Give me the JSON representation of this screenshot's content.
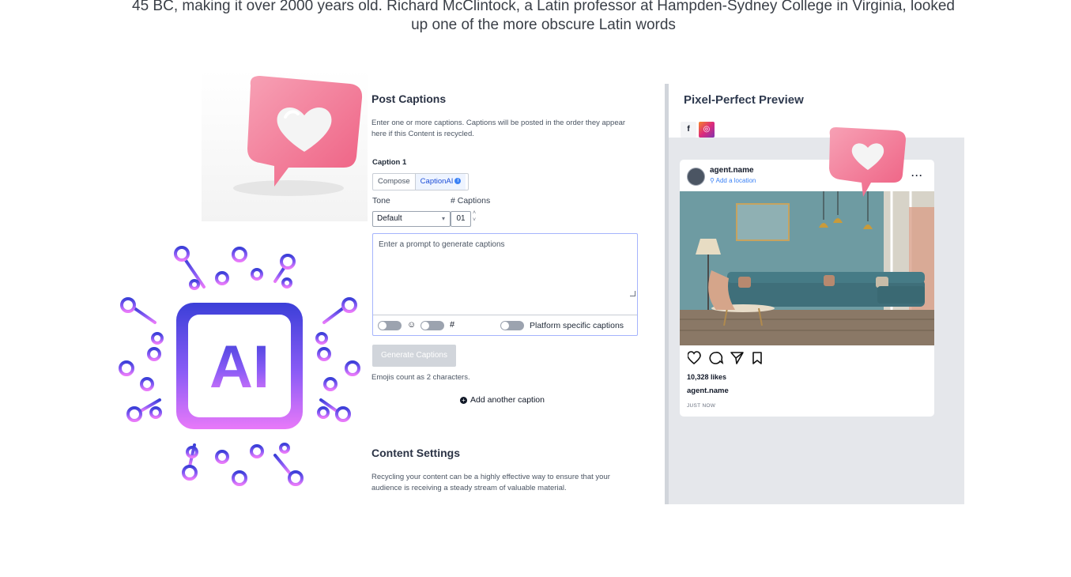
{
  "intro_text": "45 BC, making it over 2000 years old. Richard McClintock, a Latin professor at Hampden-Sydney College in Virginia, looked up one of the more obscure Latin words",
  "post_captions": {
    "title": "Post Captions",
    "description": "Enter one or more captions. Captions will be posted in the order they appear here if this Content is recycled.",
    "caption_label": "Caption 1",
    "tabs": [
      {
        "label": "Compose",
        "active": false
      },
      {
        "label": "CaptionAI",
        "active": true
      }
    ],
    "tabs_info_glyph": "i",
    "tone_label": "Tone",
    "captions_count_label": "# Captions",
    "tone_value": "Default",
    "captions_count_value": "01",
    "prompt_placeholder": "Enter a prompt to generate captions",
    "emoji_glyph": "☺",
    "hashtag_glyph": "#",
    "platform_specific_label": "Platform specific captions",
    "generate_button_label": "Generate Captions",
    "emoji_note": "Emojis count as 2 characters.",
    "add_caption_label": "Add another caption"
  },
  "content_settings": {
    "title": "Content Settings",
    "description": "Recycling your content can be a highly effective way to ensure that your audience is receiving a steady stream of valuable material."
  },
  "preview": {
    "title": "Pixel-Perfect Preview",
    "tabs": [
      {
        "icon": "facebook-icon",
        "glyph": "f"
      },
      {
        "icon": "instagram-icon",
        "glyph": "◎"
      }
    ],
    "post": {
      "username": "agent.name",
      "location": "Add a location",
      "more_glyph": "···",
      "likes": "10,328 likes",
      "caption_username": "agent.name",
      "timestamp": "JUST NOW"
    }
  },
  "ai_logo_text": "AI",
  "colors": {
    "accent_blue": "#1d4ed8",
    "heart_pink": "#f27593",
    "ai_gradient_top": "#4338ca",
    "ai_gradient_bottom": "#e879f9"
  }
}
